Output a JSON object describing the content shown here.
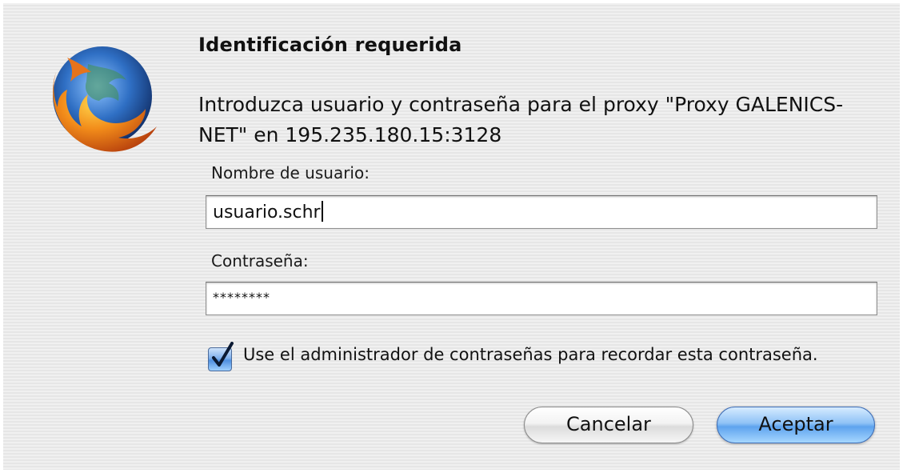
{
  "dialog": {
    "title": "Identificación requerida",
    "message": "Introduzca usuario y contraseña para el proxy \"Proxy GALENICS-NET\" en 195.235.180.15:3128",
    "icon": "firefox-logo"
  },
  "username": {
    "label": "Nombre de usuario:",
    "value": "usuario.schr"
  },
  "password": {
    "label": "Contraseña:",
    "value": "********"
  },
  "remember": {
    "checked": true,
    "label": "Use el administrador de contraseñas para recordar esta contraseña."
  },
  "buttons": {
    "cancel": "Cancelar",
    "accept": "Aceptar"
  },
  "colors": {
    "accent": "#5ea3ee",
    "dialog_background": "#ececec"
  }
}
